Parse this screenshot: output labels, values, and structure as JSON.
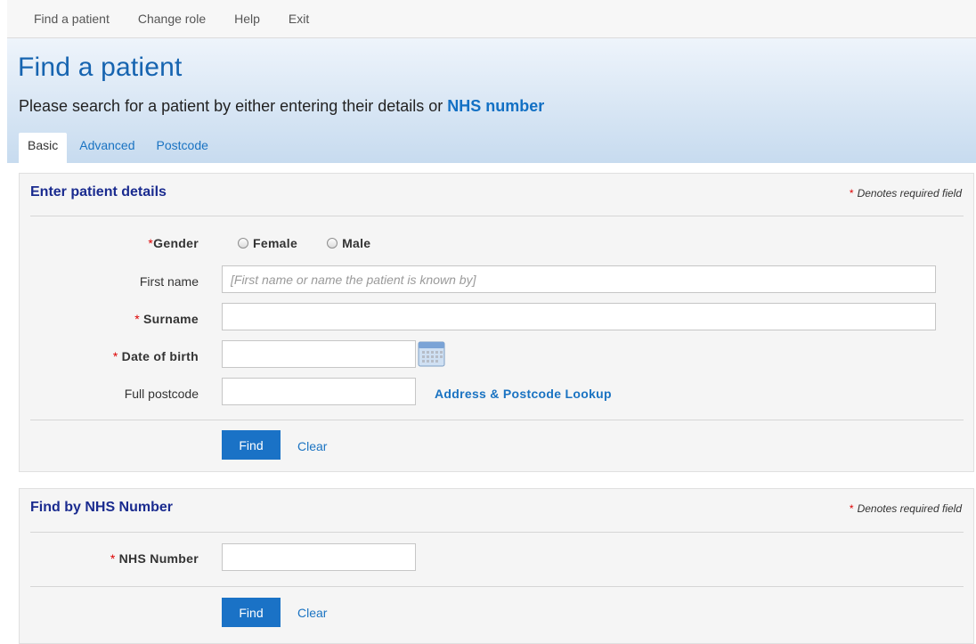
{
  "nav": {
    "items": [
      "Find a patient",
      "Change role",
      "Help",
      "Exit"
    ]
  },
  "header": {
    "title": "Find a patient",
    "subtitle_prefix": "Please search for a patient by either entering their details or ",
    "subtitle_link": "NHS number"
  },
  "tabs": [
    {
      "label": "Basic",
      "active": true
    },
    {
      "label": "Advanced",
      "active": false
    },
    {
      "label": "Postcode",
      "active": false
    }
  ],
  "details_panel": {
    "title": "Enter patient details",
    "required_note": "Denotes required field",
    "required_star": "*",
    "gender": {
      "label": "Gender",
      "options": [
        "Female",
        "Male"
      ]
    },
    "first_name": {
      "label": "First name",
      "value": "",
      "placeholder": "[First name or name the patient is known by]"
    },
    "surname": {
      "label": "Surname",
      "value": ""
    },
    "dob": {
      "label": "Date of birth",
      "value": ""
    },
    "postcode": {
      "label": "Full postcode",
      "value": ""
    },
    "address_lookup": "Address & Postcode Lookup",
    "find_label": "Find",
    "clear_label": "Clear"
  },
  "nhs_panel": {
    "title": "Find by NHS Number",
    "required_note": "Denotes required field",
    "required_star": "*",
    "nhs_number": {
      "label": "NHS Number",
      "value": ""
    },
    "find_label": "Find",
    "clear_label": "Clear"
  },
  "colors": {
    "accent": "#1a72c6",
    "panel_title": "#1a2b8f",
    "required": "#dd0000"
  }
}
